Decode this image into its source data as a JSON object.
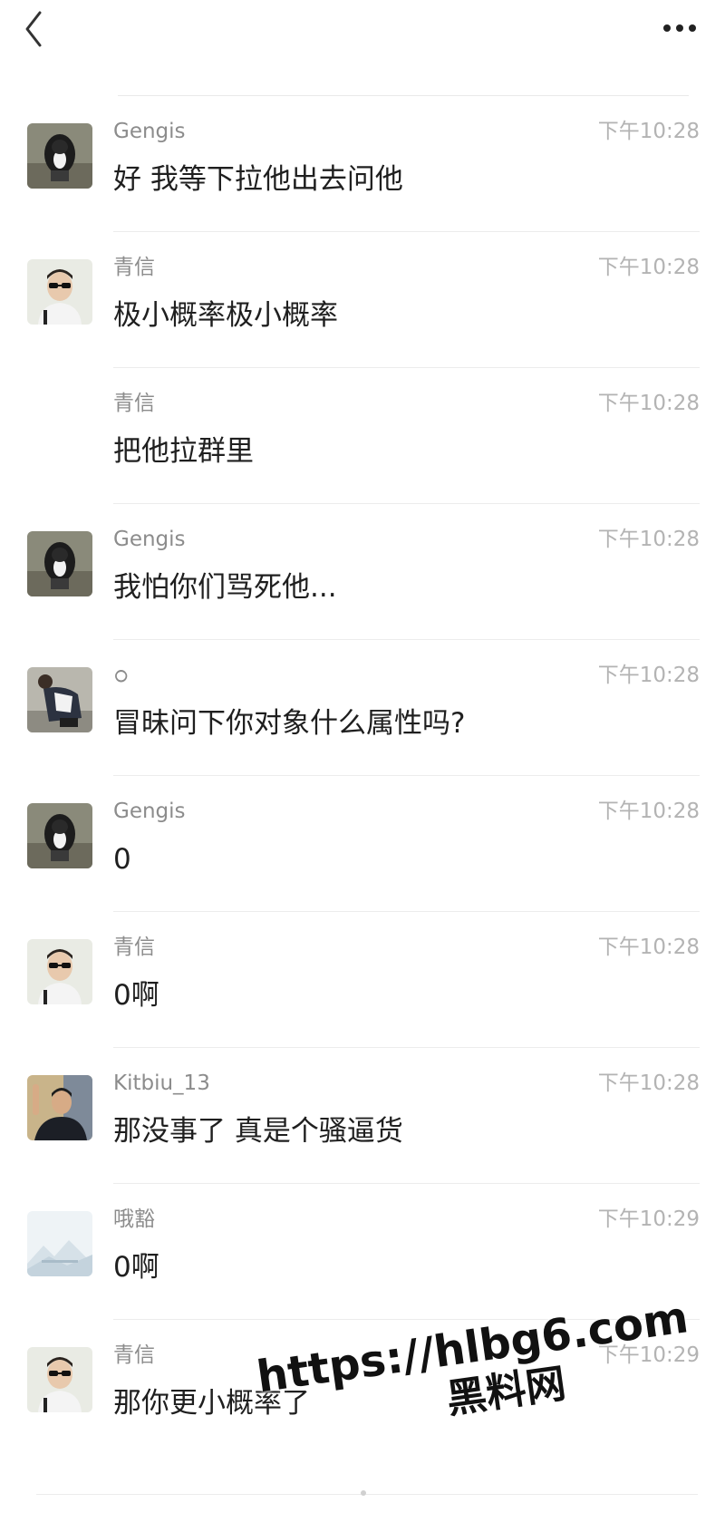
{
  "header": {
    "back_icon": "chevron-left-icon",
    "more_icon": "more-dots-icon"
  },
  "messages": [
    {
      "sender": "Gengis",
      "time": "下午10:28",
      "text": "好 我等下拉他出去问他",
      "avatar": "dog-avatar"
    },
    {
      "sender": "青信",
      "time": "下午10:28",
      "text": "极小概率极小概率",
      "avatar": "sunglasses-man-avatar"
    },
    {
      "sender": "青信",
      "time": "下午10:28",
      "text": "把他拉群里",
      "avatar": ""
    },
    {
      "sender": "Gengis",
      "time": "下午10:28",
      "text": "我怕你们骂死他...",
      "avatar": "dog-avatar"
    },
    {
      "sender": "ഠ",
      "time": "下午10:28",
      "text": "冒昧问下你对象什么属性吗?",
      "avatar": "person-avatar"
    },
    {
      "sender": "Gengis",
      "time": "下午10:28",
      "text": "0",
      "avatar": "dog-avatar"
    },
    {
      "sender": "青信",
      "time": "下午10:28",
      "text": "0啊",
      "avatar": "sunglasses-man-avatar"
    },
    {
      "sender": "Kitbiu_13",
      "time": "下午10:28",
      "text": "那没事了 真是个骚逼货",
      "avatar": "waving-man-avatar"
    },
    {
      "sender": "哦豁",
      "time": "下午10:29",
      "text": "0啊",
      "avatar": "landscape-avatar"
    },
    {
      "sender": "青信",
      "time": "下午10:29",
      "text": "那你更小概率了",
      "avatar": "sunglasses-man-avatar"
    }
  ],
  "watermark": {
    "url": "https://hlbg6.com",
    "site": "黑料网"
  }
}
